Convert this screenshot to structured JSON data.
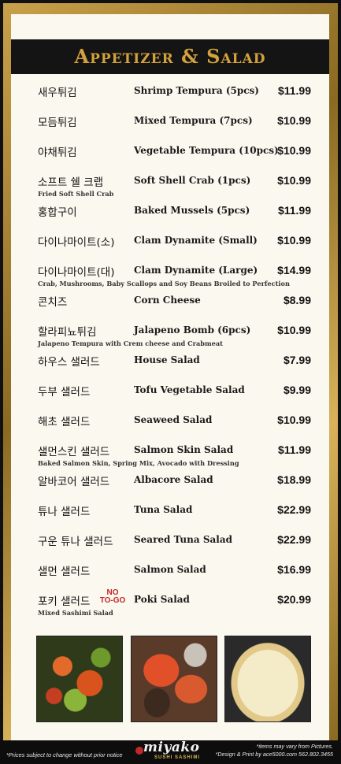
{
  "title": "Appetizer & Salad",
  "items": [
    {
      "ko": "새우튀김",
      "en": "Shrimp Tempura (5pcs)",
      "price": "$11.99",
      "sub": ""
    },
    {
      "ko": "모듬튀김",
      "en": "Mixed Tempura (7pcs)",
      "price": "$10.99",
      "sub": ""
    },
    {
      "ko": "야채튀김",
      "en": "Vegetable Tempura (10pcs)",
      "price": "$10.99",
      "sub": ""
    },
    {
      "ko": "소프트 쉘 크랩",
      "en": "Soft Shell Crab (1pcs)",
      "price": "$10.99",
      "sub": "Fried Soft Shell Crab"
    },
    {
      "ko": "홍합구이",
      "en": "Baked Mussels (5pcs)",
      "price": "$11.99",
      "sub": ""
    },
    {
      "ko": "다이나마이트(소)",
      "en": "Clam Dynamite (Small)",
      "price": "$10.99",
      "sub": ""
    },
    {
      "ko": "다이나마이트(대)",
      "en": "Clam Dynamite (Large)",
      "price": "$14.99",
      "sub": "Crab, Mushrooms, Baby Scallops and Soy Beans Broiled to Perfection"
    },
    {
      "ko": "콘치즈",
      "en": "Corn Cheese",
      "price": "$8.99",
      "sub": ""
    },
    {
      "ko": "할라피뇨튀김",
      "en": "Jalapeno Bomb (6pcs)",
      "price": "$10.99",
      "sub": "Jalapeno Tempura with Crem cheese and Crabmeat"
    },
    {
      "ko": "하우스 샐러드",
      "en": "House Salad",
      "price": "$7.99",
      "sub": ""
    },
    {
      "ko": "두부 샐러드",
      "en": "Tofu Vegetable Salad",
      "price": "$9.99",
      "sub": ""
    },
    {
      "ko": "해초 샐러드",
      "en": "Seaweed Salad",
      "price": "$10.99",
      "sub": ""
    },
    {
      "ko": "샐먼스킨 샐러드",
      "en": "Salmon Skin Salad",
      "price": "$11.99",
      "sub": "Baked Salmon Skin, Spring Mix, Avocado with Dressing"
    },
    {
      "ko": "알바코어 샐러드",
      "en": "Albacore Salad",
      "price": "$18.99",
      "sub": ""
    },
    {
      "ko": "튜나 샐러드",
      "en": "Tuna Salad",
      "price": "$22.99",
      "sub": ""
    },
    {
      "ko": "구운 튜나 샐러드",
      "en": "Seared Tuna Salad",
      "price": "$22.99",
      "sub": ""
    },
    {
      "ko": "샐먼 샐러드",
      "en": "Salmon Salad",
      "price": "$16.99",
      "sub": ""
    },
    {
      "ko": "포키 샐러드",
      "en": "Poki Salad",
      "price": "$20.99",
      "sub": "Mixed Sashimi Salad",
      "badge": "NO TO-GO"
    }
  ],
  "footer": {
    "left_note": "*Prices subject to change without prior notice",
    "logo_main": "miyako",
    "logo_sub": "SUSHI  SASHIMI",
    "right_line1": "*items may vary from Pictures.",
    "right_line2": "*Design & Print by ace5000.com 562.802.3455"
  },
  "colors": {
    "title": "#d4a23c",
    "badge": "#c0282a",
    "header_bg": "#141414",
    "card_bg": "#fbf8ef"
  }
}
